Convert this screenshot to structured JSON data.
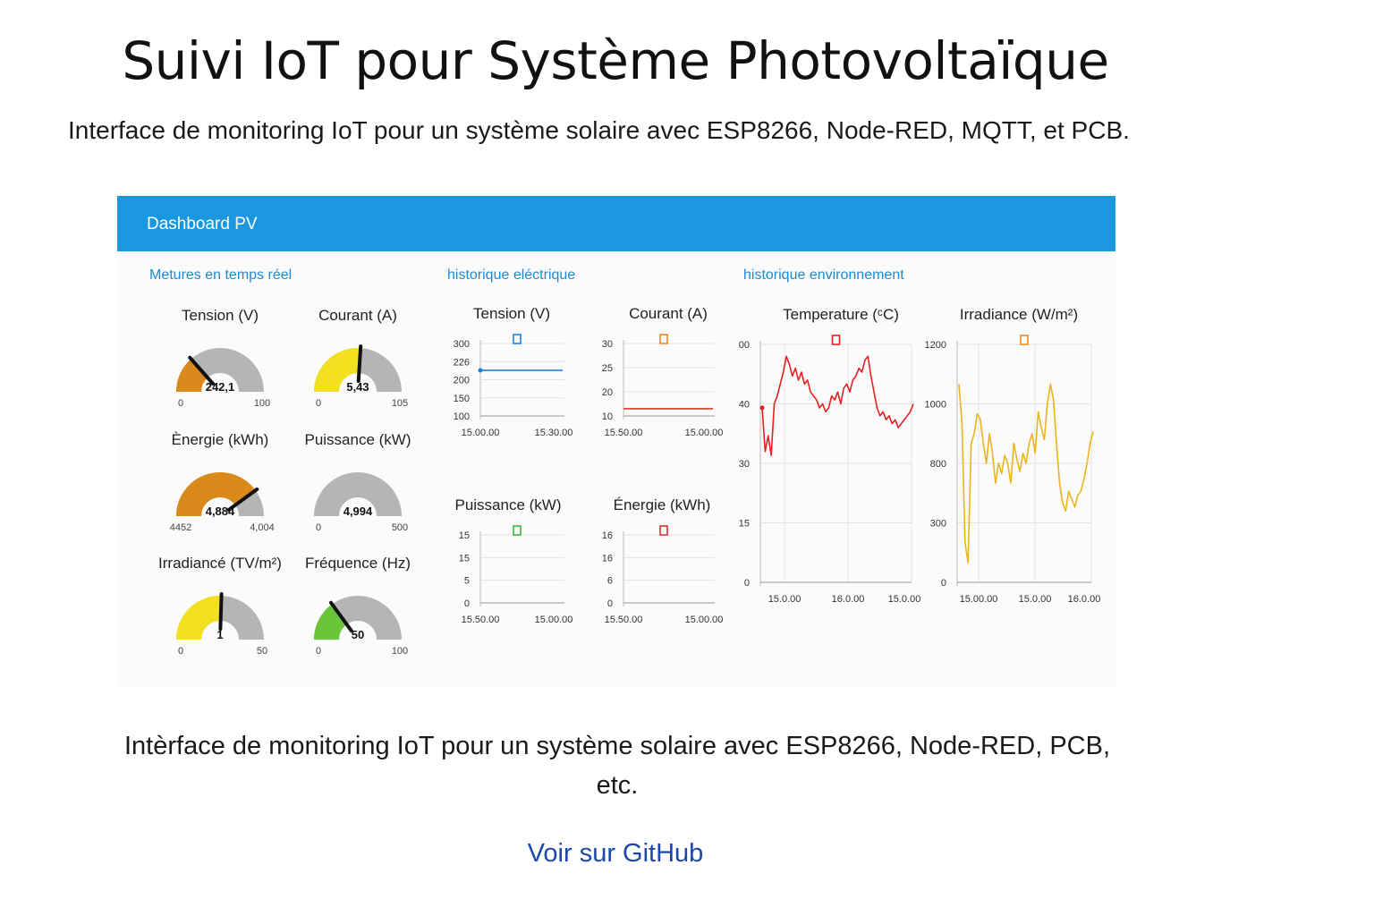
{
  "page": {
    "title": "Suivi IoT pour Système Photovoltaïque",
    "subtitle": "Interface de monitoring IoT pour un système solaire avec ESP8266, Node-RED, MQTT, et PCB.",
    "description": "Intèrface de monitoring IoT pour un système solaire avec ESP8266, Node-RED, PCB, etc.",
    "github_link": "Voir sur GitHub"
  },
  "dashboard": {
    "header_title": "Dashboard PV",
    "header_color": "#1b97e0",
    "sections": {
      "realtime": "Metures en temps réel",
      "electrical": "historique eléctrique",
      "environment": "historique environnement"
    },
    "gauges": [
      {
        "title": "Tension (V)",
        "value": 242.1,
        "value_label": "242,1",
        "min_label": "0",
        "max_label": "100",
        "fraction": 0.27,
        "color": "#d98a1a"
      },
      {
        "title": "Courant (A)",
        "value": 5.43,
        "value_label": "5,43",
        "min_label": "0",
        "max_label": "105",
        "fraction": 0.52,
        "color": "#f3e020"
      },
      {
        "title": "Ènergie (kWh)",
        "value": 4.884,
        "value_label": "4,884",
        "min_label": "4452",
        "max_label": "4,004",
        "fraction": 0.8,
        "color": "#d98a1a"
      },
      {
        "title": "Puissance (kW)",
        "value": 4.994,
        "value_label": "4,994",
        "min_label": "0",
        "max_label": "500",
        "fraction": 0.0,
        "color": "#b5b5b5"
      },
      {
        "title": "Irradiancé (TV/m²)",
        "value": 1,
        "value_label": "1",
        "min_label": "0",
        "max_label": "50",
        "fraction": 0.51,
        "color": "#f3e020"
      },
      {
        "title": "Fréquence (Hz)",
        "value": 50,
        "value_label": "50",
        "min_label": "0",
        "max_label": "100",
        "fraction": 0.3,
        "color": "#6cc43a"
      }
    ],
    "gauge_track_color": "#b5b5b5"
  },
  "chart_data": [
    {
      "type": "line",
      "title": "Tension (V)",
      "yticks": [
        "300",
        "226",
        "200",
        "150",
        "100"
      ],
      "xticks": [
        "15.00.00",
        "15.30.00"
      ],
      "ylim": [
        100,
        300
      ],
      "color": "#1b7fe0",
      "legend": "marker",
      "series": [
        {
          "x": [
            0,
            1
          ],
          "y": [
            226,
            226
          ]
        }
      ]
    },
    {
      "type": "line",
      "title": "Courant (A)",
      "yticks": [
        "30",
        "25",
        "20",
        "10"
      ],
      "xticks": [
        "15.50.00",
        "15.00.00"
      ],
      "ylim": [
        10,
        30
      ],
      "color": "#d83a1a",
      "legend_color": "#f08a1a",
      "legend": "marker",
      "series": [
        {
          "x": [
            0,
            1
          ],
          "y": [
            12,
            12
          ]
        }
      ]
    },
    {
      "type": "line",
      "title": "Puissance (kW)",
      "yticks": [
        "15",
        "15",
        "5",
        "0"
      ],
      "xticks": [
        "15.50.00",
        "15.00.00"
      ],
      "color": "#3cb83c",
      "legend": "marker",
      "series": []
    },
    {
      "type": "line",
      "title": "Énergie (kWh)",
      "yticks": [
        "16",
        "16",
        "6",
        "0"
      ],
      "xticks": [
        "15.50.00",
        "15.00.00"
      ],
      "color": "#e03030",
      "legend": "marker",
      "series": []
    },
    {
      "type": "line",
      "title": "Temperature (ᶜC)",
      "yticks": [
        "00",
        "40",
        "30",
        "15",
        "0"
      ],
      "xticks": [
        "15.0.00",
        "16.0.00",
        "15.0.00"
      ],
      "ylim": [
        0,
        60
      ],
      "color": "#e82020",
      "legend": "marker",
      "series": [
        {
          "y": [
            44,
            33,
            37,
            32,
            45,
            47,
            50,
            53,
            57,
            55,
            52,
            54,
            51,
            53,
            50,
            51,
            48,
            47,
            46,
            44,
            45,
            43,
            44,
            47,
            46,
            48,
            45,
            49,
            50,
            48,
            51,
            52,
            54,
            53,
            56,
            57,
            52,
            48,
            44,
            42,
            43,
            41,
            42,
            40,
            41,
            39,
            40,
            41,
            42,
            43,
            45
          ]
        }
      ]
    },
    {
      "type": "line",
      "title": "Irradiance (W/m²)",
      "yticks": [
        "1200",
        "1000",
        "800",
        "300",
        "0"
      ],
      "xticks": [
        "15.00.00",
        "15.0.00",
        "16.0.00"
      ],
      "ylim": [
        0,
        1200
      ],
      "color": "#eab51c",
      "legend_color": "#f08a1a",
      "legend": "marker",
      "series": [
        {
          "y": [
            1000,
            800,
            200,
            100,
            700,
            750,
            850,
            820,
            700,
            600,
            750,
            650,
            500,
            600,
            550,
            640,
            600,
            500,
            700,
            620,
            560,
            650,
            600,
            700,
            750,
            650,
            860,
            780,
            720,
            900,
            1000,
            920,
            700,
            500,
            400,
            360,
            460,
            420,
            380,
            440,
            460,
            520,
            600,
            700,
            760
          ]
        }
      ]
    }
  ]
}
